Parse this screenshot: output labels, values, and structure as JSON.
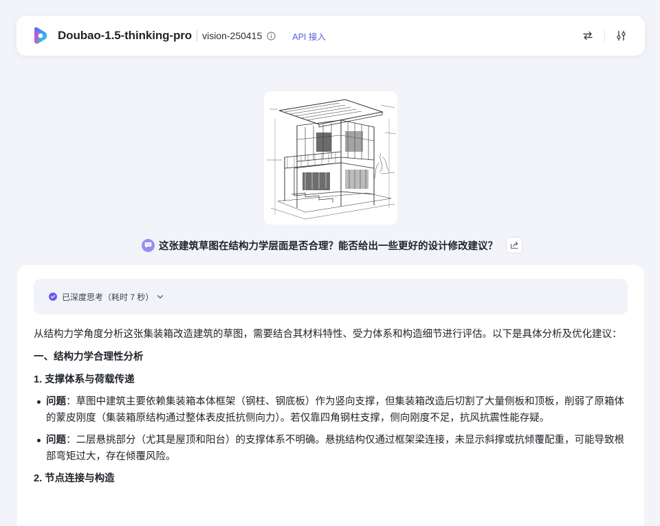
{
  "header": {
    "model_name": "Doubao-1.5-thinking-pro",
    "model_version": "vision-250415",
    "api_link": "API 接入",
    "accent_color": "#4e5fe0"
  },
  "icons": {
    "logo": "doubao-logo-icon",
    "info": "info-icon",
    "swap": "swap-icon",
    "settings": "sliders-icon",
    "question": "chat-bubble-icon",
    "share": "share-icon",
    "thinking_check": "check-circle-icon",
    "chevron": "chevron-down-icon"
  },
  "question": {
    "text": "这张建筑草图在结构力学层面是否合理？能否给出一些更好的设计修改建议？"
  },
  "answer": {
    "thinking_label": "已深度思考（耗时 7 秒）",
    "intro": "从结构力学角度分析这张集装箱改造建筑的草图，需要结合其材料特性、受力体系和构造细节进行评估。以下是具体分析及优化建议：",
    "section1_title": "一、结构力学合理性分析",
    "sub1_title": "1. 支撑体系与荷载传递",
    "bullets": [
      {
        "label": "问题",
        "text": "：草图中建筑主要依赖集装箱本体框架（钢柱、钢底板）作为竖向支撑，但集装箱改造后切割了大量侧板和顶板，削弱了原箱体的蒙皮刚度（集装箱原结构通过整体表皮抵抗侧向力）。若仅靠四角钢柱支撑，侧向刚度不足，抗风抗震性能存疑。"
      },
      {
        "label": "问题",
        "text": "：二层悬挑部分（尤其是屋顶和阳台）的支撑体系不明确。悬挑结构仅通过框架梁连接，未显示斜撑或抗倾覆配重，可能导致根部弯矩过大，存在倾覆风险。"
      }
    ],
    "sub2_title": "2. 节点连接与构造"
  }
}
